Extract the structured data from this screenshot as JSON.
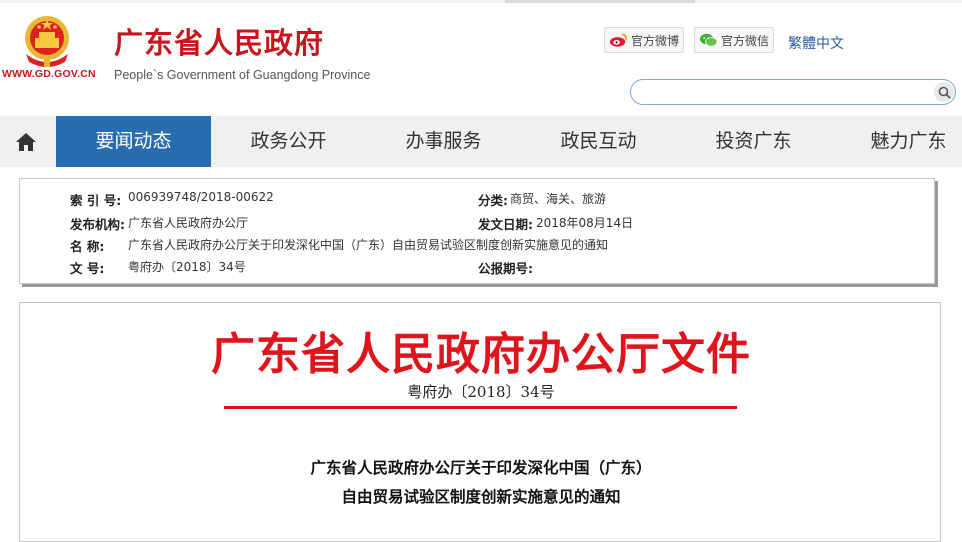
{
  "header": {
    "site_url": "WWW.GD.GOV.CN",
    "site_name": "广东省人民政府",
    "site_name_en": "People`s Government of Guangdong Province",
    "weibo_label": "官方微博",
    "weixin_label": "官方微信",
    "lang_link": "繁體中文",
    "search_placeholder": "",
    "search_icon": "magnifier",
    "emblem_icon": "national-emblem"
  },
  "nav": {
    "home_icon": "home",
    "items": [
      {
        "label": "要闻动态",
        "active": true
      },
      {
        "label": "政务公开",
        "active": false
      },
      {
        "label": "办事服务",
        "active": false
      },
      {
        "label": "政民互动",
        "active": false
      },
      {
        "label": "投资广东",
        "active": false
      },
      {
        "label": "魅力广东",
        "active": false
      }
    ]
  },
  "meta": {
    "index_label": "索 引 号:",
    "index_value": "006939748/2018-00622",
    "category_label": "分类:",
    "category_value": "商贸、海关、旅游",
    "issuer_label": "发布机构:",
    "issuer_value": "广东省人民政府办公厅",
    "date_label": "发文日期:",
    "date_value": "2018年08月14日",
    "name_label": "名 称:",
    "name_value": "广东省人民政府办公厅关于印发深化中国（广东）自由贸易试验区制度创新实施意见的通知",
    "docno_label": "文 号:",
    "docno_value": "粤府办〔2018〕34号",
    "gazette_label": "公报期号:",
    "gazette_value": ""
  },
  "document": {
    "header_title": "广东省人民政府办公厅文件",
    "doc_number": "粤府办〔2018〕34号",
    "title_line1": "广东省人民政府办公厅关于印发深化中国（广东）",
    "title_line2": "自由贸易试验区制度创新实施意见的通知"
  },
  "colors": {
    "brand_red": "#c8161d",
    "nav_active": "#2a6cb0",
    "doc_red": "#e0141c"
  }
}
